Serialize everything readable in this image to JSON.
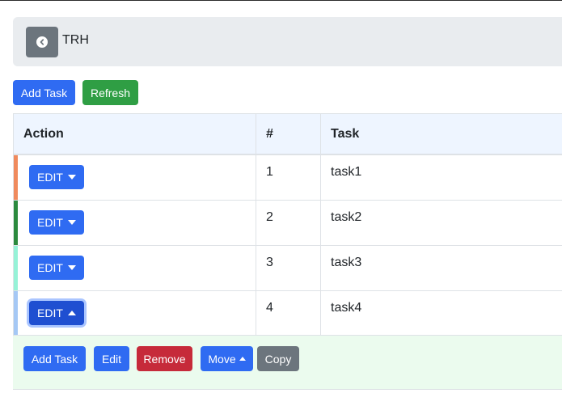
{
  "header": {
    "title": "TRH"
  },
  "toolbar": {
    "add_task_label": "Add Task",
    "refresh_label": "Refresh"
  },
  "table": {
    "columns": [
      "Action",
      "#",
      "Task"
    ],
    "rows": [
      {
        "number": "1",
        "task": "task1",
        "edit_label": "EDIT",
        "stripe_color": "#f08a5d"
      },
      {
        "number": "2",
        "task": "task2",
        "edit_label": "EDIT",
        "stripe_color": "#2b8a3e"
      },
      {
        "number": "3",
        "task": "task3",
        "edit_label": "EDIT",
        "stripe_color": "#96f2d7"
      },
      {
        "number": "4",
        "task": "task4",
        "edit_label": "EDIT",
        "stripe_color": "#a5c8f5"
      }
    ]
  },
  "actions": {
    "add_task_label": "Add Task",
    "edit_label": "Edit",
    "remove_label": "Remove",
    "move_label": "Move",
    "copy_label": "Copy"
  },
  "colors": {
    "primary": "#2f6bf2",
    "success": "#2f9e44",
    "danger": "#c62a3a",
    "secondary": "#6c757d",
    "panel_bg": "#ebfbee",
    "header_bg": "#e9ecef"
  }
}
